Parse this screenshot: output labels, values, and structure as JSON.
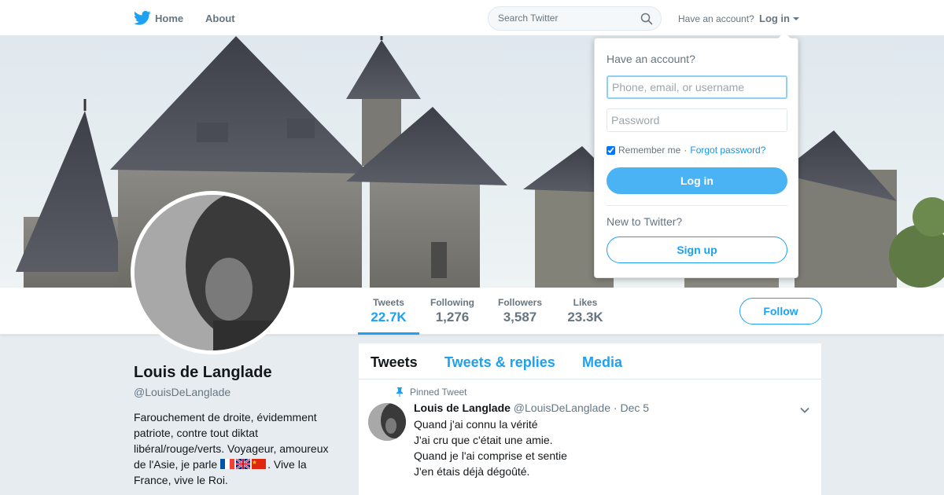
{
  "nav": {
    "home_label": "Home",
    "about_label": "About",
    "search_placeholder": "Search Twitter",
    "have_account_text": "Have an account?",
    "login_label": "Log in",
    "brand_color": "#1da1f2"
  },
  "profile": {
    "name": "Louis de Langlade",
    "handle": "@LouisDeLanglade",
    "bio_before_flags": "Farouchement de droite, évidemment patriote, contre tout diktat libéral/rouge/verts. Voyageur, amoureux de l'Asie, je parle ",
    "bio_flags": [
      "france-flag",
      "uk-flag",
      "china-flag"
    ],
    "bio_after_flags": ". Vive la France, vive le Roi.",
    "follow_label": "Follow"
  },
  "stats": [
    {
      "label": "Tweets",
      "value": "22.7K"
    },
    {
      "label": "Following",
      "value": "1,276"
    },
    {
      "label": "Followers",
      "value": "3,587"
    },
    {
      "label": "Likes",
      "value": "23.3K"
    }
  ],
  "timeline": {
    "tabs": [
      "Tweets",
      "Tweets & replies",
      "Media"
    ],
    "active_tab": "Tweets",
    "pinned_tweet": {
      "pinned_label": "Pinned Tweet",
      "author_name": "Louis de Langlade",
      "author_handle": "@LouisDeLanglade",
      "separator": "·",
      "date": "Dec 5",
      "lines": [
        "Quand j'ai connu la vérité",
        "J'ai cru que c'était une amie.",
        "Quand je l'ai comprise et sentie",
        "J'en étais déjà dégoûté."
      ]
    }
  },
  "login_dropdown": {
    "title": "Have an account?",
    "username_placeholder": "Phone, email, or username",
    "password_placeholder": "Password",
    "remember_me_label": "Remember me",
    "separator": "·",
    "forgot_password_label": "Forgot password?",
    "login_button_label": "Log in",
    "new_to_twitter_text": "New to Twitter?",
    "signup_button_label": "Sign up"
  }
}
